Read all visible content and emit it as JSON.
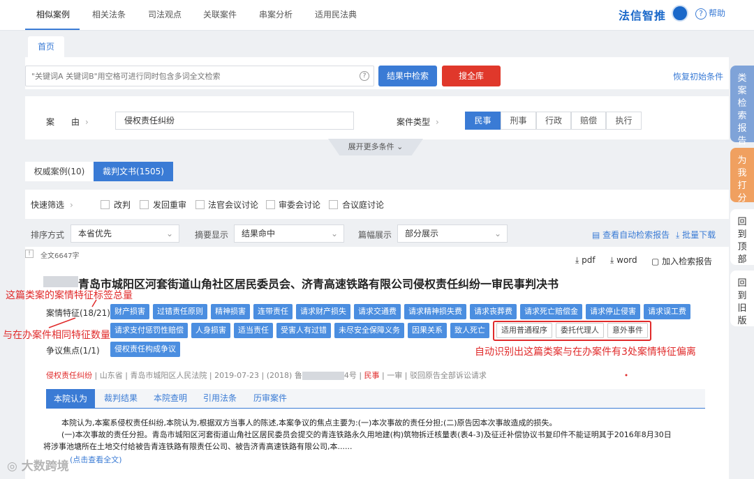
{
  "topnav": {
    "tabs": [
      "相似案例",
      "相关法条",
      "司法观点",
      "关联案件",
      "串案分析",
      "适用民法典"
    ],
    "logo": "法信智推",
    "help": "帮助"
  },
  "home_tab": "首页",
  "search": {
    "placeholder": "\"关键词A 关键词B\"用空格可进行同时包含多词全文检索",
    "search_in_results": "结果中检索",
    "search_all": "搜全库",
    "restore": "恢复初始条件"
  },
  "filters": {
    "cause_label": "案　　由",
    "cause_value": "侵权责任纠纷",
    "case_type_label": "案件类型",
    "case_types": [
      "民事",
      "刑事",
      "行政",
      "赔偿",
      "执行"
    ],
    "expand": "展开更多条件"
  },
  "doc_tabs": [
    "权威案例(10)",
    "裁判文书(1505)"
  ],
  "quick": {
    "label": "快速筛选",
    "options": [
      "改判",
      "发回重审",
      "法官会议讨论",
      "审委会讨论",
      "合议庭讨论"
    ]
  },
  "sort": {
    "order_label": "排序方式",
    "order_value": "本省优先",
    "summary_label": "摘要显示",
    "summary_value": "结果命中",
    "length_label": "篇幅展示",
    "length_value": "部分展示",
    "view_report": "查看自动检索报告",
    "batch_download": "批量下载"
  },
  "result": {
    "fulltext": "全文6647字",
    "actions": [
      "pdf",
      "word",
      "加入检索报告"
    ],
    "title": "青岛市城阳区河套街道山角社区居民委员会、济青高速铁路有限公司侵权责任纠纷一审民事判决书",
    "features_label": "案情特征(18/21)",
    "features_row1": [
      "财产损害",
      "过错责任原则",
      "精神损害",
      "连带责任",
      "请求财产损失",
      "请求交通费",
      "请求精神损失费",
      "请求丧葬费",
      "请求死亡赔偿金",
      "请求停止侵害",
      "请求误工费"
    ],
    "features_row2": [
      "请求支付惩罚性赔偿",
      "人身损害",
      "适当责任",
      "受害人有过错",
      "未尽安全保障义务",
      "因果关系",
      "致人死亡"
    ],
    "features_diff": [
      "适用普通程序",
      "委托代理人",
      "意外事件"
    ],
    "dispute_label": "争议焦点(1/1)",
    "dispute": [
      "侵权责任构成争议"
    ],
    "meta": [
      "侵权责任纠纷",
      "山东省",
      "青岛市城阳区人民法院",
      "2019-07-23",
      "(2018) 鲁",
      "4号",
      "民事",
      "一审",
      "驳回原告全部诉讼请求"
    ],
    "content_tabs": [
      "本院认为",
      "裁判结果",
      "本院查明",
      "引用法条",
      "历审案件"
    ],
    "para1": "本院认为,本案系侵权责任纠纷,本院认为,根据双方当事人的陈述,本案争议的焦点主要为:(一)本次事故的责任分担;(二)原告因本次事故造成的损失。",
    "para2": "(一)本次事故的责任分担。青岛市城阳区河套街道山角社区居民委员会提交的青连铁路永久用地建(构)筑物拆迁核量表(表4-3)及征迁补偿协议书复印件不能证明其于2016年8月30日",
    "para3": "将涉事池塘所在土地交付给被告青连铁路有限责任公司、被告济青高速铁路有限公司,本......",
    "more": "(点击查看全文)"
  },
  "annotations": [
    "这篇类案的案情特征标签总量",
    "与在办案件相同特征数量",
    "自动识别出这篇类案与在办案件有3处案情特征偏离"
  ],
  "side": [
    "类案检索报告",
    "为我打分",
    "回到顶部",
    "回到旧版"
  ],
  "watermark": "大数跨境",
  "colors": {
    "accent": "#3a7bd5",
    "danger": "#e02a2a",
    "tag": "#4b8ee0"
  }
}
